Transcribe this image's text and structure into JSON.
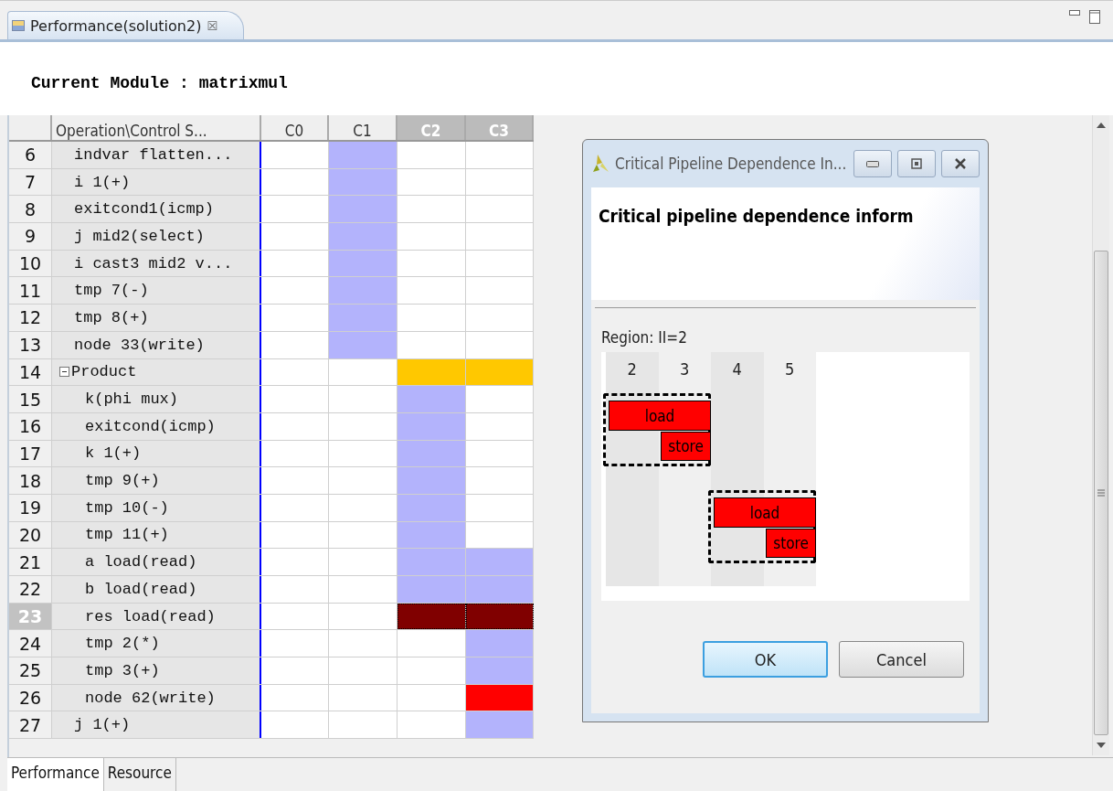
{
  "editor_tab": {
    "title": "Performance(solution2)",
    "close": "☒"
  },
  "module_label": "Current Module : matrixmul",
  "table": {
    "columns": [
      {
        "label": "Operation\\Control S...",
        "selected": false
      },
      {
        "label": "C0",
        "selected": false
      },
      {
        "label": "C1",
        "selected": false
      },
      {
        "label": "C2",
        "selected": true
      },
      {
        "label": "C3",
        "selected": true
      }
    ],
    "rows": [
      {
        "num": "6",
        "label": "indvar flatten...",
        "selected": false,
        "cells": [
          {
            "kind": "empty"
          },
          {
            "kind": "op"
          },
          {
            "kind": "empty"
          },
          {
            "kind": "empty"
          }
        ]
      },
      {
        "num": "7",
        "label": "i 1(+)",
        "selected": false,
        "cells": [
          {
            "kind": "empty"
          },
          {
            "kind": "op"
          },
          {
            "kind": "empty"
          },
          {
            "kind": "empty"
          }
        ]
      },
      {
        "num": "8",
        "label": "exitcond1(icmp)",
        "selected": false,
        "cells": [
          {
            "kind": "empty"
          },
          {
            "kind": "op"
          },
          {
            "kind": "empty"
          },
          {
            "kind": "empty"
          }
        ]
      },
      {
        "num": "9",
        "label": "j mid2(select)",
        "selected": false,
        "cells": [
          {
            "kind": "empty"
          },
          {
            "kind": "op"
          },
          {
            "kind": "empty"
          },
          {
            "kind": "empty"
          }
        ]
      },
      {
        "num": "10",
        "label": "i cast3 mid2 v...",
        "selected": false,
        "cells": [
          {
            "kind": "empty"
          },
          {
            "kind": "op"
          },
          {
            "kind": "empty"
          },
          {
            "kind": "empty"
          }
        ]
      },
      {
        "num": "11",
        "label": "tmp 7(-)",
        "selected": false,
        "cells": [
          {
            "kind": "empty"
          },
          {
            "kind": "op"
          },
          {
            "kind": "empty"
          },
          {
            "kind": "empty"
          }
        ]
      },
      {
        "num": "12",
        "label": "tmp 8(+)",
        "selected": false,
        "cells": [
          {
            "kind": "empty"
          },
          {
            "kind": "op"
          },
          {
            "kind": "empty"
          },
          {
            "kind": "empty"
          }
        ]
      },
      {
        "num": "13",
        "label": "node 33(write)",
        "selected": false,
        "cells": [
          {
            "kind": "empty"
          },
          {
            "kind": "op"
          },
          {
            "kind": "empty"
          },
          {
            "kind": "empty"
          }
        ]
      },
      {
        "num": "14",
        "label": "Product",
        "selected": false,
        "expanded": true,
        "cells": [
          {
            "kind": "empty"
          },
          {
            "kind": "empty"
          },
          {
            "kind": "loop"
          },
          {
            "kind": "loop"
          }
        ],
        "children": [
          {
            "num": "15",
            "label": "k(phi mux)",
            "selected": false,
            "cells": [
              {
                "kind": "empty"
              },
              {
                "kind": "empty"
              },
              {
                "kind": "op"
              },
              {
                "kind": "empty"
              }
            ]
          },
          {
            "num": "16",
            "label": "exitcond(icmp)",
            "selected": false,
            "cells": [
              {
                "kind": "empty"
              },
              {
                "kind": "empty"
              },
              {
                "kind": "op"
              },
              {
                "kind": "empty"
              }
            ]
          },
          {
            "num": "17",
            "label": "k 1(+)",
            "selected": false,
            "cells": [
              {
                "kind": "empty"
              },
              {
                "kind": "empty"
              },
              {
                "kind": "op"
              },
              {
                "kind": "empty"
              }
            ]
          },
          {
            "num": "18",
            "label": "tmp 9(+)",
            "selected": false,
            "cells": [
              {
                "kind": "empty"
              },
              {
                "kind": "empty"
              },
              {
                "kind": "op"
              },
              {
                "kind": "empty"
              }
            ]
          },
          {
            "num": "19",
            "label": "tmp 10(-)",
            "selected": false,
            "cells": [
              {
                "kind": "empty"
              },
              {
                "kind": "empty"
              },
              {
                "kind": "op"
              },
              {
                "kind": "empty"
              }
            ]
          },
          {
            "num": "20",
            "label": "tmp 11(+)",
            "selected": false,
            "cells": [
              {
                "kind": "empty"
              },
              {
                "kind": "empty"
              },
              {
                "kind": "op"
              },
              {
                "kind": "empty"
              }
            ]
          },
          {
            "num": "21",
            "label": "a load(read)",
            "selected": false,
            "cells": [
              {
                "kind": "empty"
              },
              {
                "kind": "empty"
              },
              {
                "kind": "op"
              },
              {
                "kind": "op"
              }
            ]
          },
          {
            "num": "22",
            "label": "b load(read)",
            "selected": false,
            "cells": [
              {
                "kind": "empty"
              },
              {
                "kind": "empty"
              },
              {
                "kind": "op"
              },
              {
                "kind": "op"
              }
            ]
          },
          {
            "num": "23",
            "label": "res load(read)",
            "selected": true,
            "cells": [
              {
                "kind": "empty"
              },
              {
                "kind": "empty"
              },
              {
                "kind": "focus"
              },
              {
                "kind": "focus"
              }
            ]
          },
          {
            "num": "24",
            "label": "tmp 2(*)",
            "selected": false,
            "cells": [
              {
                "kind": "empty"
              },
              {
                "kind": "empty"
              },
              {
                "kind": "empty"
              },
              {
                "kind": "op"
              }
            ]
          },
          {
            "num": "25",
            "label": "tmp 3(+)",
            "selected": false,
            "cells": [
              {
                "kind": "empty"
              },
              {
                "kind": "empty"
              },
              {
                "kind": "empty"
              },
              {
                "kind": "op"
              }
            ]
          },
          {
            "num": "26",
            "label": "node 62(write)",
            "selected": false,
            "cells": [
              {
                "kind": "empty"
              },
              {
                "kind": "empty"
              },
              {
                "kind": "empty"
              },
              {
                "kind": "critical"
              }
            ]
          }
        ]
      },
      {
        "num": "27",
        "label": "j 1(+)",
        "selected": false,
        "cells": [
          {
            "kind": "empty"
          },
          {
            "kind": "empty"
          },
          {
            "kind": "empty"
          },
          {
            "kind": "op"
          }
        ]
      }
    ]
  },
  "bottom_tabs": [
    {
      "label": "Performance",
      "selected": true
    },
    {
      "label": "Resource",
      "selected": false
    }
  ],
  "dialog": {
    "title": "Critical Pipeline Dependence In...",
    "heading": "Critical pipeline dependence inform",
    "region": "Region: II=2",
    "diagram": {
      "columns": [
        "2",
        "3",
        "4",
        "5"
      ],
      "groups": [
        {
          "ops": [
            {
              "label": "load"
            },
            {
              "label": "store"
            }
          ]
        },
        {
          "ops": [
            {
              "label": "load"
            },
            {
              "label": "store"
            }
          ]
        }
      ]
    },
    "buttons": [
      {
        "label": "OK",
        "selected": true
      },
      {
        "label": "Cancel",
        "selected": false
      }
    ]
  }
}
